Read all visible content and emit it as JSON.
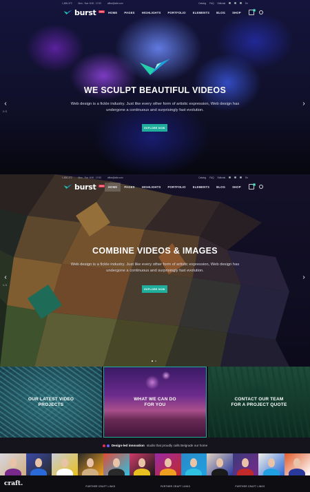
{
  "topbar": {
    "phone": "1-800-372",
    "hours": "Mon - Sun: 8:00 - 17:00",
    "email": "office@site.com",
    "links": [
      "Catalog",
      "FAQ",
      "Editorial"
    ],
    "lang": "En"
  },
  "navbar": {
    "logo_text": "burst",
    "logo_badge": "PRO",
    "menu": [
      "HOME",
      "PAGES",
      "HIGHLIGHTS",
      "PORTFOLIO",
      "ELEMENTS",
      "BLOG",
      "SHOP"
    ],
    "active_item": "HOME",
    "cart_count": "0"
  },
  "hero1": {
    "title": "WE SCULPT BEAUTIFUL VIDEOS",
    "subtitle_line1": "Web design is a fickle industry. Just like every other form of artistic expression, Web design has",
    "subtitle_line2": "undergone a continuous and surprisingly fast evolution.",
    "button": "EXPLORE NOW",
    "slide_counter": "2 / 2",
    "prev_icon": "‹",
    "next_icon": "›"
  },
  "hero2": {
    "title": "COMBINE VIDEOS & IMAGES",
    "subtitle_line1": "Web design is a fickle industry. Just like every other form of artistic expression, Web design has",
    "subtitle_line2": "undergone a continuous and surprisingly fast evolution.",
    "button": "EXPLORE NOW",
    "slide_counter": "1 / 2",
    "prev_icon": "‹",
    "next_icon": "›"
  },
  "tiles": [
    {
      "line1": "OUR LATEST VIDEO",
      "line2": "PROJECTS"
    },
    {
      "line1": "WHAT WE CAN DO",
      "line2": "FOR YOU"
    },
    {
      "line1": "CONTACT OUR TEAM",
      "line2": "FOR A PROJECT QUOTE"
    }
  ],
  "tagline": {
    "bold": "Design-led innovation",
    "rest": "studio that proudly calls Belgrade our home"
  },
  "gallery": {
    "count": 12
  },
  "footer": {
    "brand": "craft.",
    "columns": [
      "FURTHER CRAFT LINKS",
      "FURTHER CRAFT LINKS",
      "FURTHER CRAFT LINKS"
    ]
  },
  "colors": {
    "accent": "#1fae9c",
    "brand_red": "#e7304b",
    "tag_dot_1": "#e7304b",
    "tag_dot_2": "#6a5cff"
  }
}
